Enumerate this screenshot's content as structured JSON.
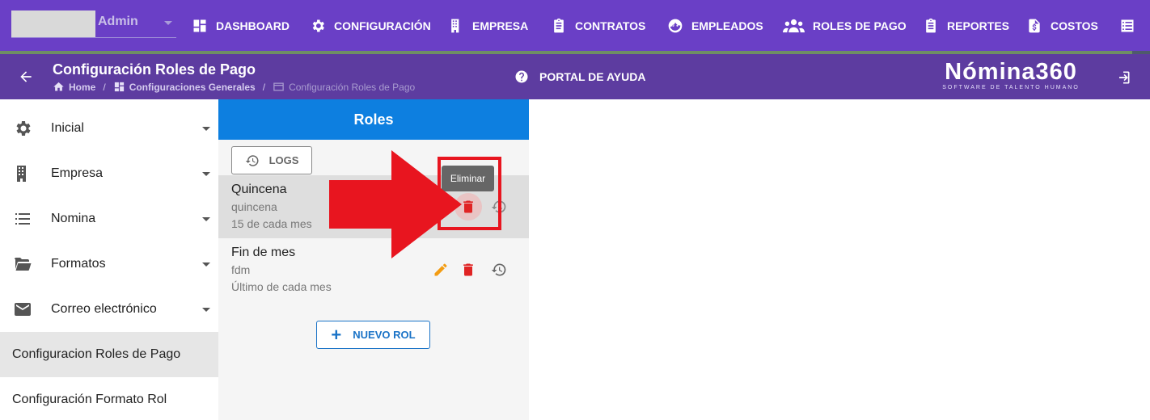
{
  "topbar": {
    "user": "Admin",
    "nav": [
      {
        "label": "DASHBOARD",
        "icon": "dashboard-icon"
      },
      {
        "label": "CONFIGURACIÓN",
        "icon": "gear-icon"
      },
      {
        "label": "EMPRESA",
        "icon": "building-icon"
      },
      {
        "label": "CONTRATOS",
        "icon": "clipboard-icon"
      },
      {
        "label": "EMPLEADOS",
        "icon": "face-icon"
      },
      {
        "label": "ROLES DE PAGO",
        "icon": "group-icon"
      },
      {
        "label": "REPORTES",
        "icon": "report-icon"
      },
      {
        "label": "COSTOS",
        "icon": "dollar-file-icon"
      },
      {
        "label": "",
        "icon": "list-icon"
      }
    ]
  },
  "subheader": {
    "title": "Configuración Roles de Pago",
    "breadcrumb": [
      "Home",
      "Configuraciones Generales",
      "Configuración Roles de Pago"
    ],
    "help": "PORTAL DE AYUDA",
    "logo_main": "Nómina360",
    "logo_sub": "SOFTWARE DE TALENTO HUMANO"
  },
  "sidebar": {
    "items": [
      {
        "label": "Inicial",
        "icon": "gear-icon"
      },
      {
        "label": "Empresa",
        "icon": "building-icon"
      },
      {
        "label": "Nomina",
        "icon": "list-icon"
      },
      {
        "label": "Formatos",
        "icon": "folder-icon"
      },
      {
        "label": "Correo electrónico",
        "icon": "mail-icon"
      },
      {
        "label": "Configuracion Roles de Pago"
      },
      {
        "label": "Configuración Formato Rol"
      }
    ]
  },
  "roles": {
    "title": "Roles",
    "logs_label": "LOGS",
    "items": [
      {
        "name": "Quincena",
        "code": "quincena",
        "desc": "15 de cada mes"
      },
      {
        "name": "Fin de mes",
        "code": "fdm",
        "desc": "Último de cada mes"
      }
    ],
    "tooltip": "Eliminar",
    "new_label": "NUEVO ROL"
  },
  "colors": {
    "topbar": "#6a3fc6",
    "subbar": "#5d3ca0",
    "panel_header": "#0d7fe0",
    "delete": "#e02424",
    "edit": "#f39c12",
    "annotation": "#e8151f"
  }
}
